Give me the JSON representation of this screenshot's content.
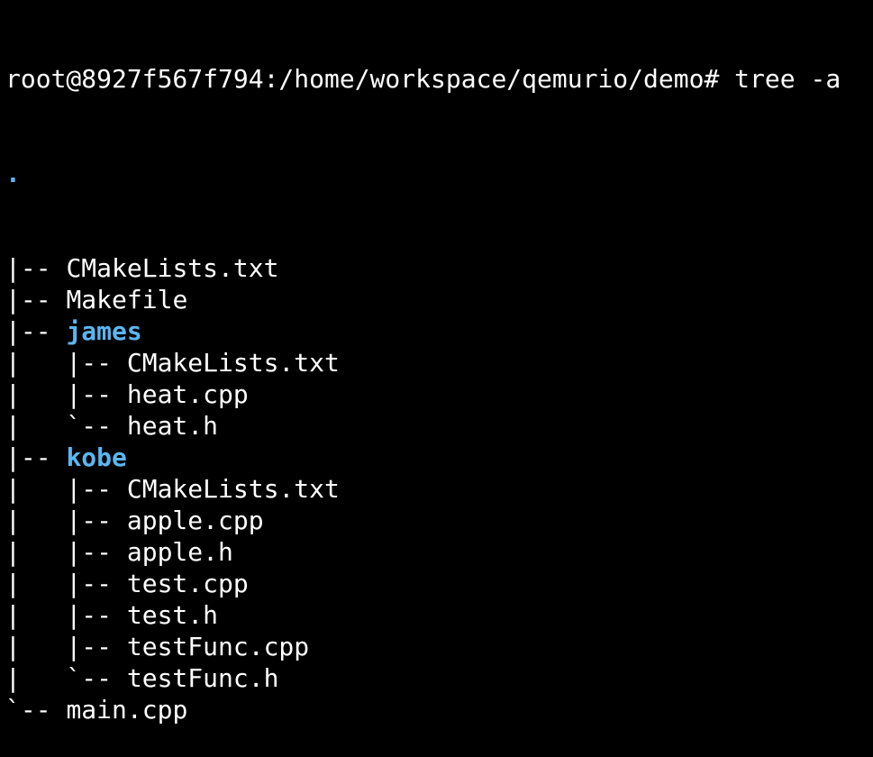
{
  "terminal": {
    "prompt": "root@8927f567f794:/home/workspace/qemurio/demo#",
    "command": "tree -a"
  },
  "colors": {
    "background": "#000000",
    "text": "#ffffff",
    "directory": "#5bb6f2"
  },
  "tree": {
    "root": ".",
    "lines": [
      {
        "prefix": "|-- ",
        "name": "CMakeLists.txt",
        "type": "file"
      },
      {
        "prefix": "|-- ",
        "name": "Makefile",
        "type": "file"
      },
      {
        "prefix": "|-- ",
        "name": "james",
        "type": "dir"
      },
      {
        "prefix": "|   |-- ",
        "name": "CMakeLists.txt",
        "type": "file"
      },
      {
        "prefix": "|   |-- ",
        "name": "heat.cpp",
        "type": "file"
      },
      {
        "prefix": "|   `-- ",
        "name": "heat.h",
        "type": "file"
      },
      {
        "prefix": "|-- ",
        "name": "kobe",
        "type": "dir"
      },
      {
        "prefix": "|   |-- ",
        "name": "CMakeLists.txt",
        "type": "file"
      },
      {
        "prefix": "|   |-- ",
        "name": "apple.cpp",
        "type": "file"
      },
      {
        "prefix": "|   |-- ",
        "name": "apple.h",
        "type": "file"
      },
      {
        "prefix": "|   |-- ",
        "name": "test.cpp",
        "type": "file"
      },
      {
        "prefix": "|   |-- ",
        "name": "test.h",
        "type": "file"
      },
      {
        "prefix": "|   |-- ",
        "name": "testFunc.cpp",
        "type": "file"
      },
      {
        "prefix": "|   `-- ",
        "name": "testFunc.h",
        "type": "file"
      },
      {
        "prefix": "`-- ",
        "name": "main.cpp",
        "type": "file"
      }
    ]
  }
}
